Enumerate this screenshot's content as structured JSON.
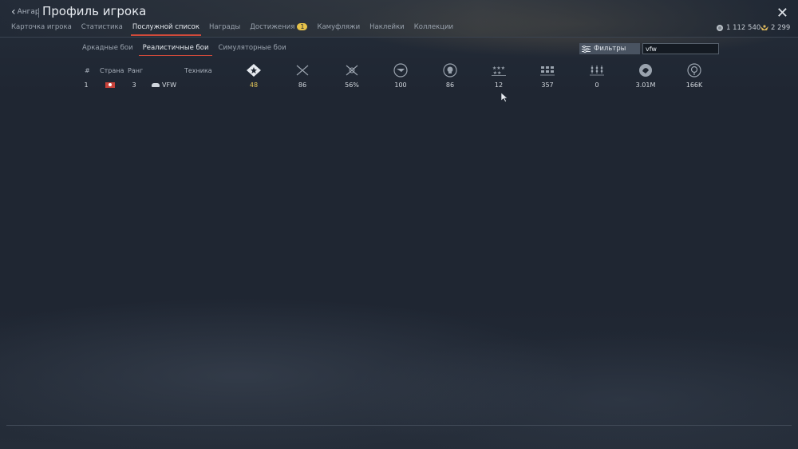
{
  "header": {
    "back_label": "Ангар",
    "title": "Профиль игрока"
  },
  "tabs": [
    {
      "label": "Карточка игрока"
    },
    {
      "label": "Статистика"
    },
    {
      "label": "Послужной список",
      "active": true
    },
    {
      "label": "Награды"
    },
    {
      "label": "Достижения",
      "badge": "1"
    },
    {
      "label": "Камуфляжи"
    },
    {
      "label": "Наклейки"
    },
    {
      "label": "Коллекции"
    }
  ],
  "currency": {
    "silver_lions": "1 112 540",
    "golden_eagles": "2 299"
  },
  "modes": [
    {
      "label": "Аркадные бои"
    },
    {
      "label": "Реалистичные бои",
      "active": true
    },
    {
      "label": "Симуляторные бои"
    }
  ],
  "filters": {
    "label": "Фильтры",
    "search_value": "vfw"
  },
  "table": {
    "columns": [
      "#",
      "Страна",
      "Ранг",
      "Техника"
    ],
    "stat_icons": [
      "battles-icon",
      "victories-icon",
      "win-rate-icon",
      "respawns-icon",
      "deaths-icon",
      "air-kills-icon",
      "ground-kills-icon",
      "naval-kills-icon",
      "experience-icon",
      "flight-time-icon"
    ],
    "rows": [
      {
        "index": "1",
        "country_flag": "flag-icon",
        "rank": "3",
        "vehicle": "VFW",
        "stats": [
          "48",
          "86",
          "56%",
          "100",
          "86",
          "12",
          "357",
          "0",
          "3.01M",
          "166K"
        ]
      }
    ]
  },
  "colors": {
    "accent": "#d24a3a",
    "highlight_value": "#e8c95a"
  }
}
